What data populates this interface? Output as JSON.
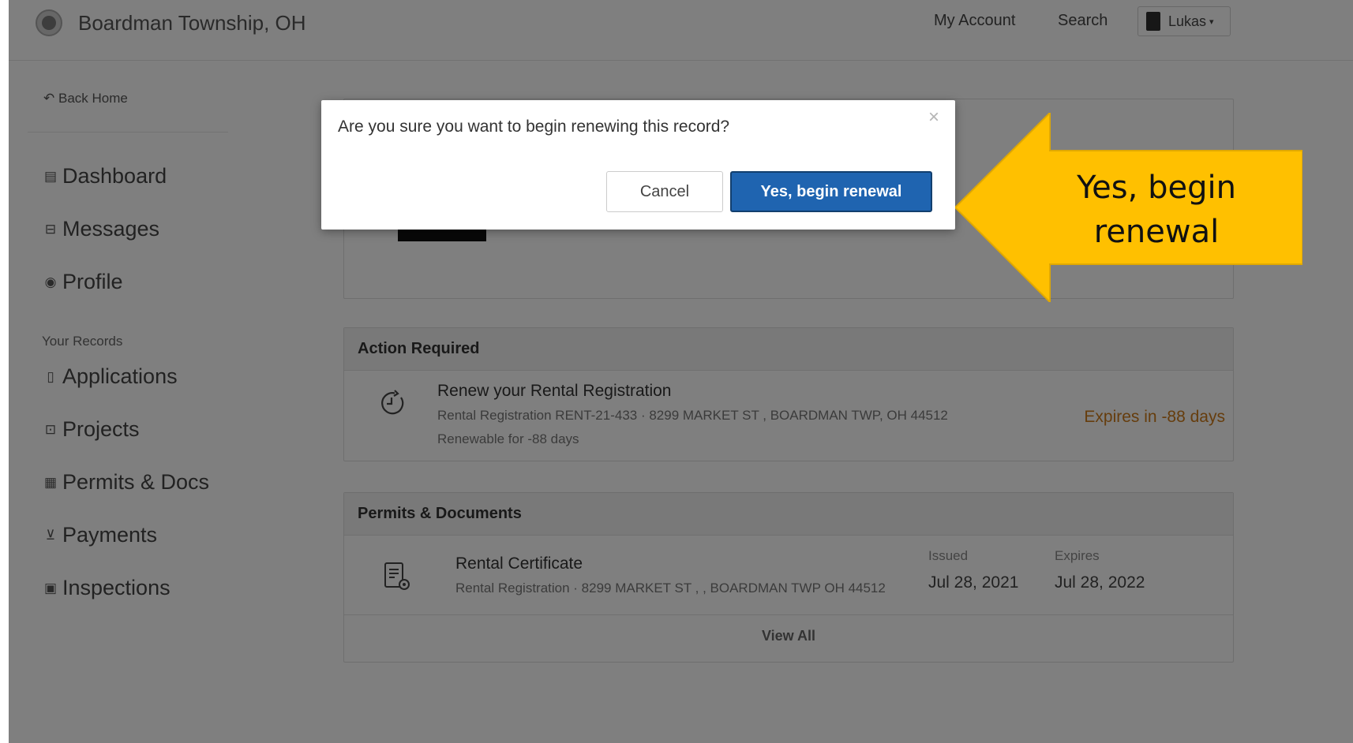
{
  "header": {
    "brand": "Boardman Township, OH",
    "nav": [
      "My Account",
      "Search"
    ],
    "user_label": "Lukas",
    "user_caret": "▾"
  },
  "sidebar": {
    "back_home": "Back Home",
    "items_top": [
      {
        "label": "Dashboard",
        "icon": "dashboard-icon"
      },
      {
        "label": "Messages",
        "icon": "inbox-icon"
      },
      {
        "label": "Profile",
        "icon": "profile-icon"
      }
    ],
    "section_label": "Your Records",
    "items_records": [
      {
        "label": "Applications",
        "icon": "document-icon"
      },
      {
        "label": "Projects",
        "icon": "briefcase-icon"
      },
      {
        "label": "Permits & Docs",
        "icon": "permit-icon"
      },
      {
        "label": "Payments",
        "icon": "cart-icon"
      },
      {
        "label": "Inspections",
        "icon": "clipboard-icon"
      }
    ]
  },
  "action_required": {
    "heading": "Action Required",
    "title": "Renew your Rental Registration",
    "subtitle": "Rental Registration RENT-21-433 · 8299 MARKET ST , BOARDMAN TWP, OH 44512",
    "renewable": "Renewable for -88 days",
    "expires": "Expires in -88 days",
    "expires_color": "#cc7a1a"
  },
  "permits_documents": {
    "heading": "Permits & Documents",
    "title": "Rental Certificate",
    "subtitle": "Rental Registration · 8299 MARKET ST , , BOARDMAN TWP OH 44512",
    "issued_label": "Issued",
    "issued_value": "Jul 28, 2021",
    "expires_label": "Expires",
    "expires_value": "Jul 28, 2022",
    "view_all": "View All"
  },
  "modal": {
    "question": "Are you sure you want to begin renewing this record?",
    "close": "×",
    "cancel": "Cancel",
    "confirm": "Yes, begin renewal",
    "confirm_color": "#1f64b0"
  },
  "callout": {
    "line1": "Yes, begin",
    "line2": "renewal",
    "color": "#ffc000"
  }
}
